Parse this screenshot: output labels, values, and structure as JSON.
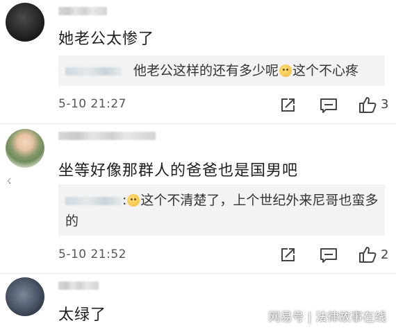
{
  "comments": [
    {
      "text": "她老公太惨了",
      "reply": {
        "text_before": "他老公这样的还有多少呢",
        "text_after": "这个不心疼"
      },
      "time": "5-10 21:27",
      "likes": "3"
    },
    {
      "text": "坐等好像那群人的爸爸也是国男吧",
      "reply": {
        "prefix": ":",
        "text_line1": "这个不清楚了，上个世纪外来尼哥也蛮多",
        "text_line2": "的"
      },
      "time": "5-10 21:52",
      "likes": "2"
    },
    {
      "text": "太绿了"
    }
  ],
  "watermark": "网易号 | 法律故事在线",
  "icons": {
    "share": "share-icon",
    "comment": "comment-icon",
    "like": "thumbs-up-icon",
    "emoji": "smiley-emoji-icon"
  }
}
